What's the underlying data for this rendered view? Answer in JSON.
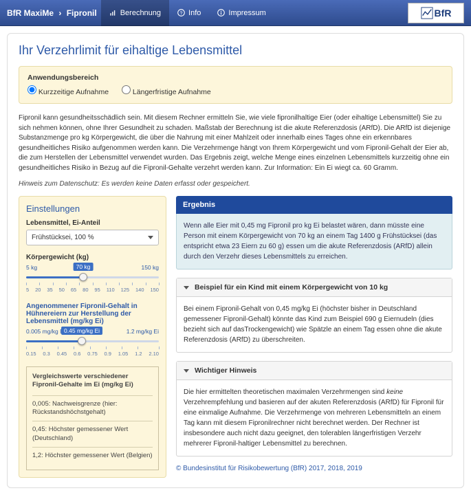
{
  "topbar": {
    "brand_left": "BfR MaxiMe",
    "brand_right": "Fipronil",
    "nav": [
      {
        "label": "Berechnung",
        "icon": "chart-icon"
      },
      {
        "label": "Info",
        "icon": "help-icon"
      },
      {
        "label": "Impressum",
        "icon": "info-icon"
      }
    ],
    "logo_text": "BfR"
  },
  "page_title": "Ihr Verzehrlimit für eihaltige Lebensmittel",
  "scope": {
    "label": "Anwendungsbereich",
    "opt1": "Kurzzeitige Aufnahme",
    "opt2": "Längerfristige Aufnahme",
    "selected": "opt1"
  },
  "intro": "Fipronil kann gesundheitsschädlich sein. Mit diesem Rechner ermitteln Sie, wie viele fipronilhaltige Eier (oder eihaltige Lebensmittel) Sie zu sich nehmen können, ohne Ihrer Gesundheit zu schaden. Maßstab der Berechnung ist die akute Referenzdosis (ARfD). Die ARfD ist diejenige Substanzmenge pro kg Körpergewicht, die über die Nahrung mit einer Mahlzeit oder innerhalb eines Tages ohne ein erkennbares gesundheitliches Risiko aufgenommen werden kann. Die Verzehrmenge hängt von Ihrem Körpergewicht und vom Fipronil-Gehalt der Eier ab, die zum Herstellen der Lebensmittel verwendet wurden. Das Ergebnis zeigt, welche Menge eines einzelnen Lebensmittels kurzzeitig ohne ein gesundheitliches Risiko in Bezug auf die Fipronil-Gehalte verzehrt werden kann. Zur Information: Ein Ei wiegt ca. 60 Gramm.",
  "privacy": "Hinweis zum Datenschutz: Es werden keine Daten erfasst oder gespeichert.",
  "settings": {
    "heading": "Einstellungen",
    "food_label": "Lebensmittel, Ei-Anteil",
    "food_value": "Frühstücksei, 100 %",
    "weight": {
      "label": "Körpergewicht (kg)",
      "min_label": "5 kg",
      "max_label": "150 kg",
      "value": 70,
      "value_label": "70 kg",
      "pct": 43,
      "ticks": [
        "5",
        "20",
        "35",
        "50",
        "65",
        "80",
        "95",
        "110",
        "125",
        "140",
        "150"
      ]
    },
    "fipronil": {
      "label": "Angenommener Fipronil-Gehalt in Hühnereiern zur Herstellung der Lebensmittel (mg/kg Ei)",
      "min_label": "0.005 mg/kg Ei",
      "max_label": "1.2 mg/kg Ei",
      "value": 0.45,
      "value_label": "0.45 mg/kg Ei",
      "pct": 42,
      "ticks": [
        "0.15",
        "0.3",
        "0.45",
        "0.6",
        "0.75",
        "0.9",
        "1.05",
        "1.2",
        "2.10"
      ]
    },
    "compare": {
      "heading": "Vergleichswerte verschiedener Fipronil-Gehalte im Ei (mg/kg Ei)",
      "rows": [
        "0,005: Nachweisgrenze (hier: Rückstandshöchstgehalt)",
        "0,45: Höchster gemessener Wert (Deutschland)",
        "1,2: Höchster gemessener Wert (Belgien)"
      ]
    }
  },
  "result": {
    "heading": "Ergebnis",
    "text": "Wenn alle Eier mit 0,45 mg Fipronil pro kg Ei belastet wären, dann müsste eine Person mit einem Körpergewicht von 70 kg an einem Tag 1400 g Frühstücksei (das entspricht etwa 23 Eiern zu 60 g) essen um die akute Referenzdosis (ARfD) allein durch den Verzehr dieses Lebensmittels zu erreichen."
  },
  "panels": {
    "child": {
      "title": "Beispiel für ein Kind mit einem Körpergewicht von 10 kg",
      "body": "Bei einem Fipronil-Gehalt von 0,45 mg/kg Ei (höchster bisher in Deutschland gemessener Fipronil-Gehalt) könnte das Kind zum Beispiel 690 g Eiernudeln (dies bezieht sich auf dasTrockengewicht) wie Spätzle an einem Tag essen ohne die akute Referenzdosis (ARfD) zu überschreiten."
    },
    "notice": {
      "title": "Wichtiger Hinweis",
      "body_before": "Die hier ermittelten theoretischen maximalen Verzehrmengen sind ",
      "body_em": "keine",
      "body_after": " Verzehrempfehlung und basieren auf der akuten Referenzdosis (ARfD) für Fipronil für eine einmalige Aufnahme. Die Verzehrmenge von mehreren Lebensmitteln an einem Tag kann mit diesem Fipronilrechner nicht berechnet werden. Der Rechner ist insbesondere auch nicht dazu geeignet, den tolerablen längerfristigen Verzehr mehrerer Fipronil-haltiger Lebensmittel zu berechnen."
    }
  },
  "copyright": "© Bundesinstitut für Risikobewertung (BfR) 2017, 2018, 2019"
}
